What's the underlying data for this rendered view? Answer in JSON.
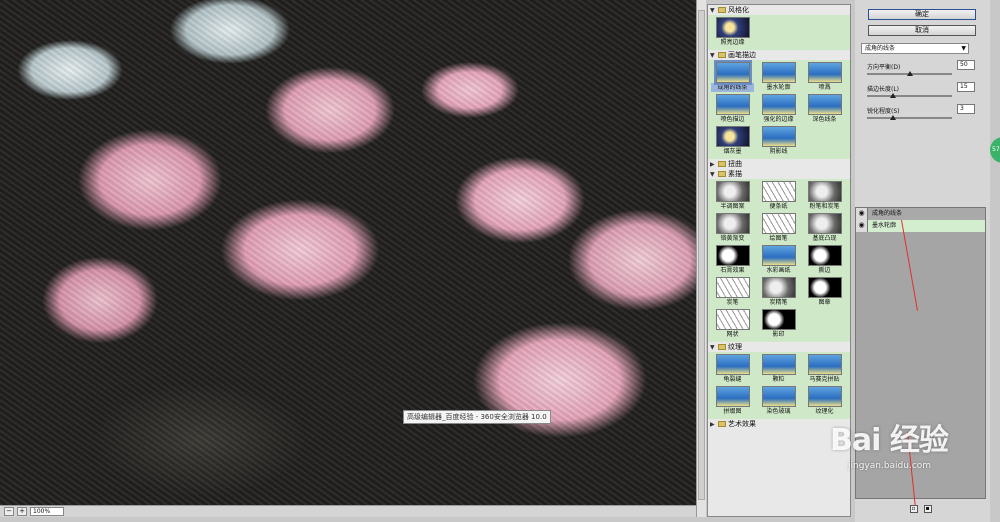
{
  "preview": {
    "tooltip": "高级编辑器_百度经验 - 360安全浏览器 10.0",
    "zoom": "100%",
    "zoom_minus": "−",
    "zoom_plus": "+"
  },
  "gallery": {
    "categories": [
      {
        "name": "风格化",
        "expanded": true,
        "items": [
          {
            "label": "照亮边缘",
            "style": "dark",
            "selected": false
          }
        ]
      },
      {
        "name": "画笔描边",
        "expanded": true,
        "items": [
          {
            "label": "成角的线条",
            "style": "blue",
            "selected": true
          },
          {
            "label": "墨水轮廓",
            "style": "blue",
            "selected": false
          },
          {
            "label": "喷溅",
            "style": "blue",
            "selected": false
          },
          {
            "label": "喷色描边",
            "style": "blue",
            "selected": false
          },
          {
            "label": "强化的边缘",
            "style": "blue",
            "selected": false
          },
          {
            "label": "深色线条",
            "style": "blue",
            "selected": false
          },
          {
            "label": "烟灰墨",
            "style": "dark",
            "selected": false
          },
          {
            "label": "阴影线",
            "style": "blue",
            "selected": false
          }
        ]
      },
      {
        "name": "扭曲",
        "expanded": false,
        "items": []
      },
      {
        "name": "素描",
        "expanded": true,
        "items": [
          {
            "label": "半调图案",
            "style": "gray",
            "selected": false
          },
          {
            "label": "便条纸",
            "style": "sketch",
            "selected": false
          },
          {
            "label": "粉笔和炭笔",
            "style": "gray",
            "selected": false
          },
          {
            "label": "铬黄渐变",
            "style": "gray",
            "selected": false
          },
          {
            "label": "绘图笔",
            "style": "sketch",
            "selected": false
          },
          {
            "label": "基底凸现",
            "style": "gray",
            "selected": false
          },
          {
            "label": "石膏效果",
            "style": "bw",
            "selected": false
          },
          {
            "label": "水彩画纸",
            "style": "blue",
            "selected": false
          },
          {
            "label": "撕边",
            "style": "bw",
            "selected": false
          },
          {
            "label": "炭笔",
            "style": "sketch",
            "selected": false
          },
          {
            "label": "炭精笔",
            "style": "gray",
            "selected": false
          },
          {
            "label": "图章",
            "style": "bw",
            "selected": false
          },
          {
            "label": "网状",
            "style": "sketch",
            "selected": false
          },
          {
            "label": "影印",
            "style": "bw",
            "selected": false
          }
        ]
      },
      {
        "name": "纹理",
        "expanded": true,
        "items": [
          {
            "label": "龟裂缝",
            "style": "blue",
            "selected": false
          },
          {
            "label": "颗粒",
            "style": "blue",
            "selected": false
          },
          {
            "label": "马赛克拼贴",
            "style": "blue",
            "selected": false
          },
          {
            "label": "拼缀图",
            "style": "blue",
            "selected": false
          },
          {
            "label": "染色玻璃",
            "style": "blue",
            "selected": false
          },
          {
            "label": "纹理化",
            "style": "blue",
            "selected": false
          }
        ]
      },
      {
        "name": "艺术效果",
        "expanded": false,
        "items": []
      }
    ]
  },
  "panel": {
    "ok_label": "确定",
    "cancel_label": "取消",
    "selected_filter": "成角的线条",
    "params": [
      {
        "label": "方向平衡(D)",
        "value": "50",
        "level": 0.5
      },
      {
        "label": "描边长度(L)",
        "value": "15",
        "level": 0.3
      },
      {
        "label": "锐化程度(S)",
        "value": "3",
        "level": 0.3
      }
    ],
    "layers": [
      {
        "name": "成角的线条",
        "active": true
      },
      {
        "name": "墨水轮廓",
        "active": false
      }
    ],
    "new_layer_icon": "new-effect-layer-icon",
    "delete_layer_icon": "delete-effect-layer-icon"
  },
  "edge_tab": {
    "label": "57"
  },
  "watermark": {
    "brand": "Bai 经验",
    "url": "jingyan.baidu.com"
  },
  "colors": {
    "selected_bg": "#9bb5dc",
    "category_bg": "#cfe8c7",
    "annotation": "#e0302a",
    "accent_green": "#3ab36a"
  }
}
